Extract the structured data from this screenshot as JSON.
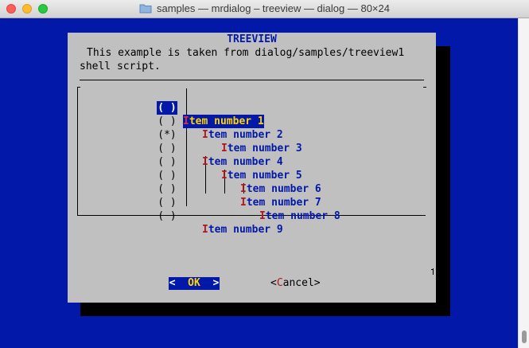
{
  "window": {
    "title": "samples — mrdialog – treeview — dialog — 80×24",
    "traffic_lights": [
      "close",
      "minimize",
      "zoom"
    ],
    "colors": {
      "terminal_bg": "#0218a8",
      "dialog_bg": "#c0c0c0",
      "highlight_fg": "#ffd400",
      "hotkey": "#b0161a"
    }
  },
  "dialog": {
    "title": "TREEVIEW",
    "description_lines": [
      "This example is taken from dialog/samples/treeview1",
      "shell script."
    ],
    "items": [
      {
        "check": "( )",
        "hotkey": "I",
        "rest": "tem number 1",
        "selected": true
      },
      {
        "check": "( )",
        "hotkey": "I",
        "rest": "tem number 2",
        "selected": false
      },
      {
        "check": "(*)",
        "hotkey": "I",
        "rest": "tem number 3",
        "selected": false
      },
      {
        "check": "( )",
        "hotkey": "I",
        "rest": "tem number 4",
        "selected": false
      },
      {
        "check": "( )",
        "hotkey": "I",
        "rest": "tem number 5",
        "selected": false
      },
      {
        "check": "( )",
        "hotkey": "I",
        "rest": "tem number 6",
        "selected": false
      },
      {
        "check": "( )",
        "hotkey": "I",
        "rest": "tem number 7",
        "selected": false
      },
      {
        "check": "( )",
        "hotkey": "I",
        "rest": "tem number 8",
        "selected": false
      },
      {
        "check": "( )",
        "hotkey": "I",
        "rest": "tem number 9",
        "selected": false
      }
    ],
    "buttons": {
      "ok": {
        "left": "<  ",
        "hotkey": "O",
        "rest": "K",
        "right": "  >"
      },
      "cancel": {
        "left": "<",
        "hotkey": "C",
        "rest": "ancel",
        "right": ">"
      }
    }
  }
}
